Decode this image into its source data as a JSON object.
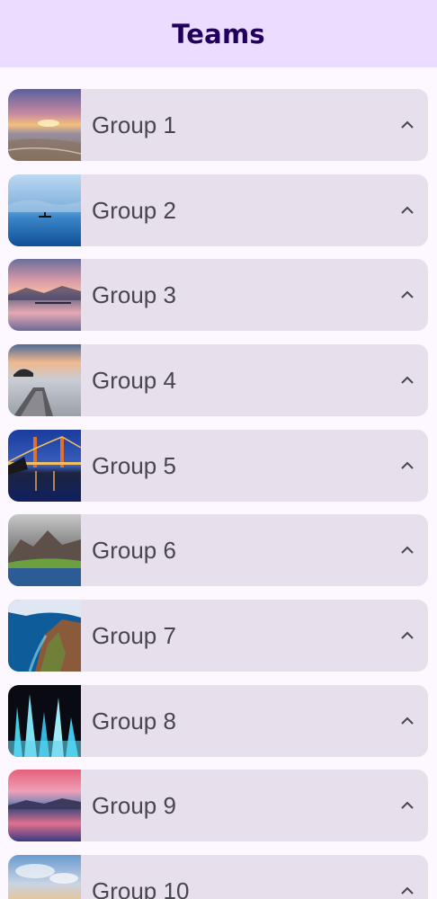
{
  "header": {
    "title": "Teams"
  },
  "groups": [
    {
      "label": "Group 1",
      "image": "beach-sunset-photo",
      "icon": "chevron-up-icon"
    },
    {
      "label": "Group 2",
      "image": "kayak-on-blue-lake-photo",
      "icon": "chevron-up-icon"
    },
    {
      "label": "Group 3",
      "image": "pink-sunset-mountains-photo",
      "icon": "chevron-up-icon"
    },
    {
      "label": "Group 4",
      "image": "rock-arch-at-dusk-photo",
      "icon": "chevron-up-icon"
    },
    {
      "label": "Group 5",
      "image": "golden-gate-bridge-night-photo",
      "icon": "chevron-up-icon"
    },
    {
      "label": "Group 6",
      "image": "misty-green-mountains-photo",
      "icon": "chevron-up-icon"
    },
    {
      "label": "Group 7",
      "image": "aerial-coastline-photo",
      "icon": "chevron-up-icon"
    },
    {
      "label": "Group 8",
      "image": "ice-waterfall-photo",
      "icon": "chevron-up-icon"
    },
    {
      "label": "Group 9",
      "image": "pink-sky-lake-photo",
      "icon": "chevron-up-icon"
    },
    {
      "label": "Group 10",
      "image": "cloudy-sky-sunset-photo",
      "icon": "chevron-up-icon"
    }
  ],
  "colors": {
    "appbar": "#eaddff",
    "title": "#21005d",
    "card": "#e7e0ec",
    "text": "#49454f",
    "background": "#fdf7ff"
  }
}
